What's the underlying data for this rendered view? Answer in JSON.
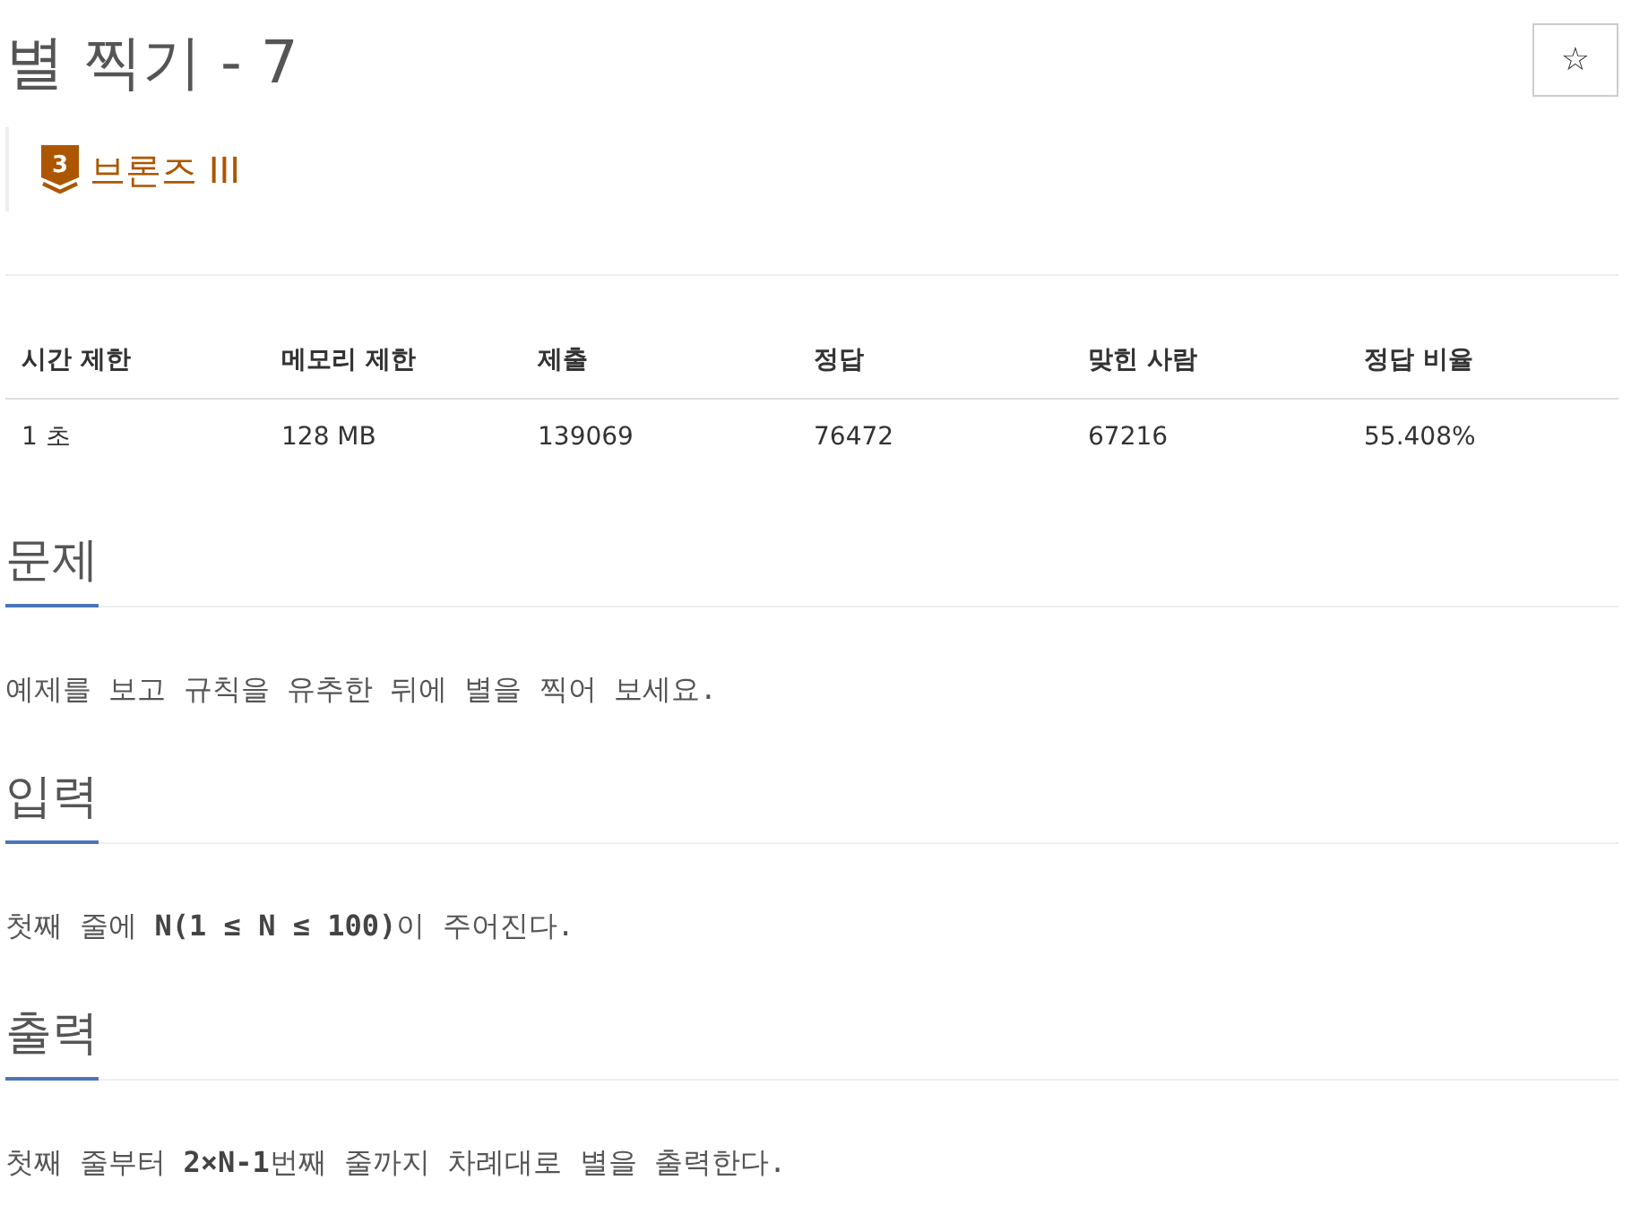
{
  "title": "별 찍기 - 7",
  "favorite_button": {
    "label": "☆"
  },
  "tier": {
    "level": "3",
    "label": "브론즈 III"
  },
  "limits_table": {
    "columns": [
      "시간 제한",
      "메모리 제한",
      "제출",
      "정답",
      "맞힌 사람",
      "정답 비율"
    ],
    "rows": [
      [
        "1 초",
        "128 MB",
        "139069",
        "76472",
        "67216",
        "55.408%"
      ]
    ]
  },
  "sections": [
    {
      "heading": "문제",
      "text": "예제를 보고 규칙을 유추한 뒤에 별을 찍어 보세요."
    },
    {
      "heading": "입력",
      "text": "첫째 줄에 **N(1 ≤ N ≤ 100)**이 주어진다."
    },
    {
      "heading": "출력",
      "text": "첫째 줄부터 **2×N-1**번째 줄까지 차례대로 별을 출력한다."
    }
  ]
}
